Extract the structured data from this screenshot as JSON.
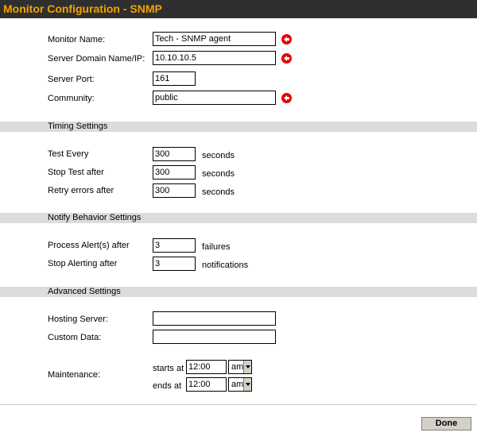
{
  "title": "Monitor Configuration - SNMP",
  "general": {
    "monitor_name_label": "Monitor Name:",
    "monitor_name_value": "Tech - SNMP agent",
    "server_domain_label": "Server Domain Name/IP:",
    "server_domain_value": "10.10.10.5",
    "server_port_label": "Server Port:",
    "server_port_value": "161",
    "community_label": "Community:",
    "community_value": "public"
  },
  "timing": {
    "section_title": "Timing Settings",
    "test_every_label": "Test Every",
    "test_every_value": "300",
    "stop_test_label": "Stop Test after",
    "stop_test_value": "300",
    "retry_errors_label": "Retry errors after",
    "retry_errors_value": "300",
    "unit": "seconds"
  },
  "notify": {
    "section_title": "Notify Behavior Settings",
    "process_alerts_label": "Process Alert(s) after",
    "process_alerts_value": "3",
    "process_alerts_unit": "failures",
    "stop_alerting_label": "Stop Alerting after",
    "stop_alerting_value": "3",
    "stop_alerting_unit": "notifications"
  },
  "advanced": {
    "section_title": "Advanced Settings",
    "hosting_server_label": "Hosting Server:",
    "hosting_server_value": "",
    "custom_data_label": "Custom Data:",
    "custom_data_value": "",
    "maintenance_label": "Maintenance:",
    "starts_at_label": "starts at",
    "starts_at_time": "12:00",
    "starts_at_ampm": "am",
    "ends_at_label": "ends at",
    "ends_at_time": "12:00",
    "ends_at_ampm": "am"
  },
  "icons": {
    "required_icon": "red-circle-left-arrow-icon",
    "required_color": "#e60000"
  },
  "done_label": "Done"
}
